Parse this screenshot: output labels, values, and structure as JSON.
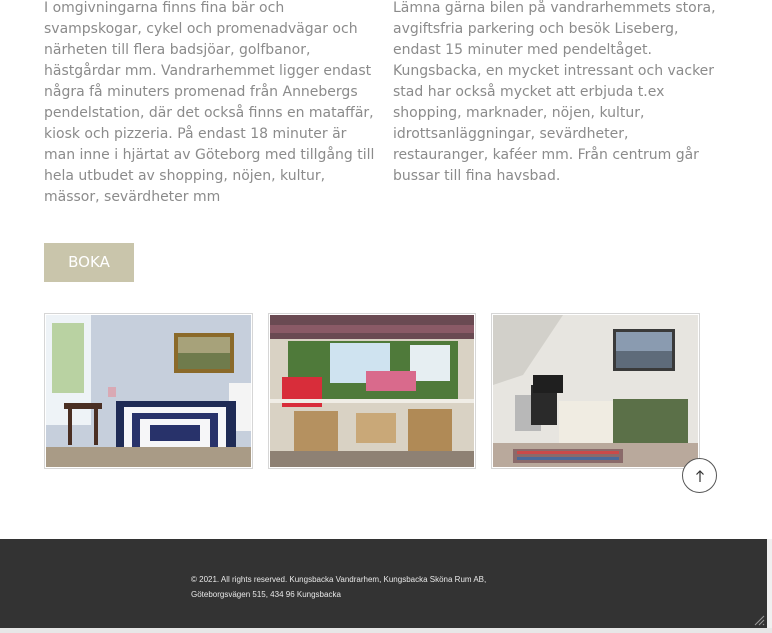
{
  "content": {
    "left_text": "I omgivningarna finns fina bär och svampskogar, cykel och promenadvägar och närheten till flera badsjöar, golfbanor, hästgårdar mm. Vandrarhemmet ligger endast några få minuters promenad från Annebergs pendelstation, där det också finns en mataffär, kiosk och pizzeria. På endast 18 minuter är man inne i hjärtat av Göteborg med tillgång till hela utbudet av shopping, nöjen, kultur, mässor, sevärdheter mm",
    "right_text": "Lämna gärna bilen på vandrarhemmets stora, avgiftsfria parkering och besök Liseberg, endast 15 minuter med pendeltåget. Kungsbacka, en mycket intressant och vacker stad har också mycket att erbjuda t.ex shopping, marknader, nöjen, kultur, idrottsanläggningar, sevärdheter, restauranger, kaféer mm. Från centrum går bussar till fina havsbad."
  },
  "booking": {
    "button_label": "BOKA"
  },
  "gallery": {
    "images": [
      {
        "icon": "bedroom-photo"
      },
      {
        "icon": "sunroom-photo"
      },
      {
        "icon": "attic-bedroom-photo"
      }
    ]
  },
  "scroll_top": {
    "icon": "arrow-up-icon"
  },
  "footer": {
    "line1": "© 2021. All rights reserved. Kungsbacka Vandrarhem, Kungsbacka Sköna Rum AB,",
    "line2": "Göteborgsvägen 515, 434 96 Kungsbacka"
  },
  "colors": {
    "button_bg": "#c9c5ab",
    "footer_bg": "#333333",
    "text": "#8b8b8b"
  }
}
